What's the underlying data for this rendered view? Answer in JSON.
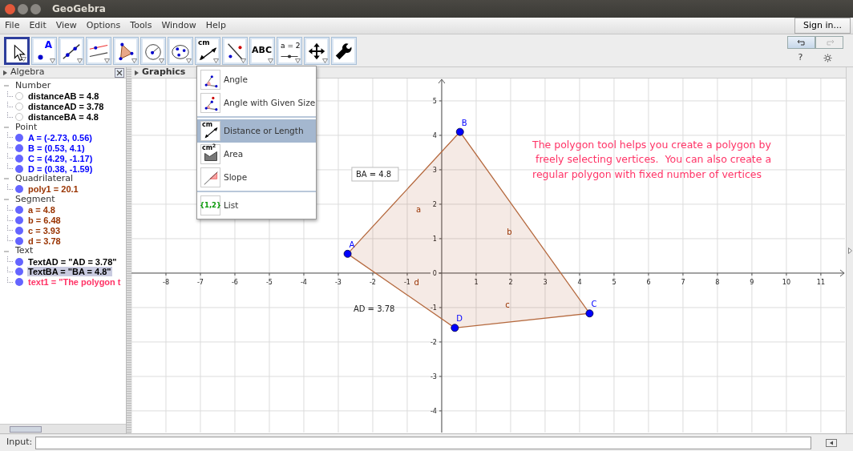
{
  "window": {
    "title": "GeoGebra"
  },
  "menu": [
    "File",
    "Edit",
    "View",
    "Options",
    "Tools",
    "Window",
    "Help"
  ],
  "sign_in": "Sign in...",
  "toolbar": {
    "tools": [
      {
        "kind": "move",
        "selected": true
      },
      {
        "kind": "point",
        "label": "A",
        "selected": false
      },
      {
        "kind": "line",
        "selected": false
      },
      {
        "kind": "parallel",
        "selected": false
      },
      {
        "kind": "polygon",
        "selected": false
      },
      {
        "kind": "circle",
        "selected": false
      },
      {
        "kind": "conic",
        "selected": false
      },
      {
        "kind": "measure",
        "label": "cm",
        "selected": false
      },
      {
        "kind": "reflect",
        "selected": false
      },
      {
        "kind": "text",
        "label": "ABC",
        "selected": false
      },
      {
        "kind": "slider",
        "label": "a = 2",
        "selected": false
      },
      {
        "kind": "move-view",
        "selected": false
      },
      {
        "kind": "wrench",
        "selected": false
      }
    ],
    "undo": {
      "disabled": false
    },
    "redo": {
      "disabled": true
    },
    "help": "?"
  },
  "tool_menu": {
    "groups": [
      [
        {
          "kind": "angle",
          "label": "Angle",
          "selected": false
        },
        {
          "kind": "angle-fixed",
          "label": "Angle with Given Size",
          "selected": false
        }
      ],
      [
        {
          "kind": "measure",
          "icon_text": "cm",
          "label": "Distance or Length",
          "selected": true
        },
        {
          "kind": "area",
          "icon_text": "cm$^{2}$",
          "label": "Area",
          "selected": false
        },
        {
          "kind": "slope",
          "label": "Slope",
          "selected": false
        }
      ],
      [
        {
          "kind": "list",
          "icon_text": "{1,2}",
          "label": "List",
          "selected": false
        }
      ]
    ]
  },
  "algebra": {
    "title": "Algebra",
    "groups": [
      {
        "label": "Number",
        "expanded": true,
        "children": [
          {
            "text": "distanceAB = 4.8",
            "visible": false,
            "selected": false,
            "color": "#000000"
          },
          {
            "text": "distanceAD = 3.78",
            "visible": false,
            "selected": false,
            "color": "#000000"
          },
          {
            "text": "distanceBA = 4.8",
            "visible": false,
            "selected": false,
            "color": "#000000"
          }
        ]
      },
      {
        "label": "Point",
        "expanded": true,
        "children": [
          {
            "text": "A = (-2.73, 0.56)",
            "visible": true,
            "selected": false,
            "color": "#0000ff"
          },
          {
            "text": "B = (0.53, 4.1)",
            "visible": true,
            "selected": false,
            "color": "#0000ff"
          },
          {
            "text": "C = (4.29, -1.17)",
            "visible": true,
            "selected": false,
            "color": "#0000ff"
          },
          {
            "text": "D = (0.38, -1.59)",
            "visible": true,
            "selected": false,
            "color": "#0000ff"
          }
        ]
      },
      {
        "label": "Quadrilateral",
        "expanded": true,
        "children": [
          {
            "text": "poly1 = 20.1",
            "visible": true,
            "selected": false,
            "color": "#993300"
          }
        ]
      },
      {
        "label": "Segment",
        "expanded": true,
        "children": [
          {
            "text": "a = 4.8",
            "visible": true,
            "selected": false,
            "color": "#993300"
          },
          {
            "text": "b = 6.48",
            "visible": true,
            "selected": false,
            "color": "#993300"
          },
          {
            "text": "c = 3.93",
            "visible": true,
            "selected": false,
            "color": "#993300"
          },
          {
            "text": "d = 3.78",
            "visible": true,
            "selected": false,
            "color": "#993300"
          }
        ]
      },
      {
        "label": "Text",
        "expanded": true,
        "children": [
          {
            "text": "TextAD = \"AD = 3.78\"",
            "visible": true,
            "selected": false,
            "color": "#000000"
          },
          {
            "text": "TextBA = \"BA = 4.8\"",
            "visible": true,
            "selected": true,
            "color": "#000000"
          },
          {
            "text": "text1 = \"The polygon t",
            "visible": true,
            "selected": false,
            "color": "#ff3366"
          }
        ]
      }
    ]
  },
  "graphics": {
    "title": "Graphics",
    "chart_data": {
      "type": "scatter",
      "grid": true,
      "xlim": [
        -9,
        11.7
      ],
      "ylim": [
        -4.63,
        5.65
      ],
      "xticks": [
        -8,
        -7,
        -6,
        -5,
        -4,
        -3,
        -2,
        -1,
        1,
        2,
        3,
        4,
        5,
        6,
        7,
        8,
        9,
        10,
        11
      ],
      "yticks": [
        -4,
        -3,
        -2,
        -1,
        0,
        1,
        2,
        3,
        4,
        5
      ],
      "x": [
        -2.73,
        0.53,
        4.29,
        0.38
      ],
      "series": [
        {
          "color": "#0000ff",
          "values": [
            0.56,
            4.1,
            -1.17,
            -1.59
          ]
        }
      ],
      "annotations": [
        {
          "text": "A",
          "x": -2.73,
          "y": 0.56
        },
        {
          "text": "B",
          "x": 0.53,
          "y": 4.1
        },
        {
          "text": "C",
          "x": 4.29,
          "y": -1.17
        },
        {
          "text": "D",
          "x": 0.38,
          "y": -1.59
        }
      ]
    },
    "segments": [
      {
        "label": "a"
      },
      {
        "label": "b"
      },
      {
        "label": "c"
      },
      {
        "label": "d"
      }
    ],
    "texts": [
      {
        "kind": "boxed",
        "text": "BA = 4.8"
      },
      {
        "kind": "plain",
        "text": "AD = 3.78"
      },
      {
        "kind": "paragraph",
        "color": "#ff3366",
        "lines": [
          "The polygon tool helps you create a polygon by",
          " freely selecting vertices.  You can also create a",
          "regular polygon with fixed number of vertices"
        ]
      }
    ]
  },
  "input": {
    "label": "Input:"
  }
}
